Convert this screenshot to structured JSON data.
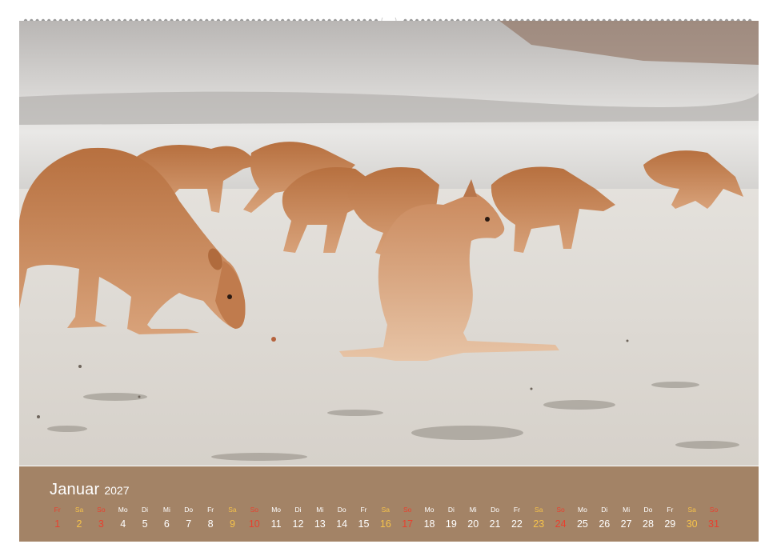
{
  "calendar": {
    "month": "Januar",
    "year": "2027",
    "colors": {
      "band": "#a38366",
      "weekday": "#ffffff",
      "saturday": "#f6c34a",
      "sunday": "#e8402e"
    },
    "days": [
      {
        "dow": "Fr",
        "num": "1",
        "type": "holiday"
      },
      {
        "dow": "Sa",
        "num": "2",
        "type": "saturday"
      },
      {
        "dow": "So",
        "num": "3",
        "type": "sunday"
      },
      {
        "dow": "Mo",
        "num": "4",
        "type": "weekday"
      },
      {
        "dow": "Di",
        "num": "5",
        "type": "weekday"
      },
      {
        "dow": "Mi",
        "num": "6",
        "type": "weekday"
      },
      {
        "dow": "Do",
        "num": "7",
        "type": "weekday"
      },
      {
        "dow": "Fr",
        "num": "8",
        "type": "weekday"
      },
      {
        "dow": "Sa",
        "num": "9",
        "type": "saturday"
      },
      {
        "dow": "So",
        "num": "10",
        "type": "sunday"
      },
      {
        "dow": "Mo",
        "num": "11",
        "type": "weekday"
      },
      {
        "dow": "Di",
        "num": "12",
        "type": "weekday"
      },
      {
        "dow": "Mi",
        "num": "13",
        "type": "weekday"
      },
      {
        "dow": "Do",
        "num": "14",
        "type": "weekday"
      },
      {
        "dow": "Fr",
        "num": "15",
        "type": "weekday"
      },
      {
        "dow": "Sa",
        "num": "16",
        "type": "saturday"
      },
      {
        "dow": "So",
        "num": "17",
        "type": "sunday"
      },
      {
        "dow": "Mo",
        "num": "18",
        "type": "weekday"
      },
      {
        "dow": "Di",
        "num": "19",
        "type": "weekday"
      },
      {
        "dow": "Mi",
        "num": "20",
        "type": "weekday"
      },
      {
        "dow": "Do",
        "num": "21",
        "type": "weekday"
      },
      {
        "dow": "Fr",
        "num": "22",
        "type": "weekday"
      },
      {
        "dow": "Sa",
        "num": "23",
        "type": "saturday"
      },
      {
        "dow": "So",
        "num": "24",
        "type": "sunday"
      },
      {
        "dow": "Mo",
        "num": "25",
        "type": "weekday"
      },
      {
        "dow": "Di",
        "num": "26",
        "type": "weekday"
      },
      {
        "dow": "Mi",
        "num": "27",
        "type": "weekday"
      },
      {
        "dow": "Do",
        "num": "28",
        "type": "weekday"
      },
      {
        "dow": "Fr",
        "num": "29",
        "type": "weekday"
      },
      {
        "dow": "Sa",
        "num": "30",
        "type": "saturday"
      },
      {
        "dow": "So",
        "num": "31",
        "type": "sunday"
      }
    ]
  }
}
